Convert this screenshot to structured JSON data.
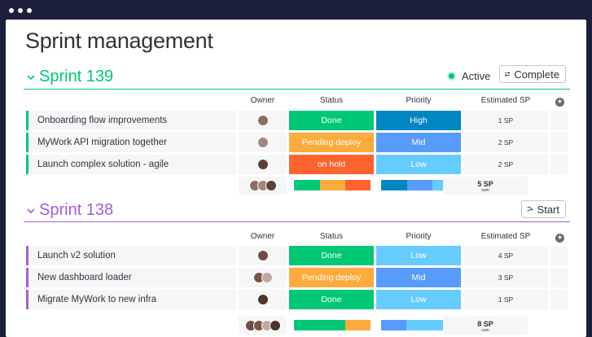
{
  "window": {
    "title": "Sprint management"
  },
  "columns": {
    "owner": "Owner",
    "status": "Status",
    "priority": "Priority",
    "estimated": "Estimated SP"
  },
  "colors": {
    "done": "#00c875",
    "pending": "#fdab3d",
    "onhold": "#ff642e",
    "high": "#0086c0",
    "mid": "#579bfc",
    "low": "#66ccff",
    "group1": "#00c875",
    "group2": "#a25ddc"
  },
  "groups": [
    {
      "name": "Sprint 139",
      "state_label": "Active",
      "action_label": "Complete",
      "action_icon": "complete-icon",
      "rows": [
        {
          "name": "Onboarding flow improvements",
          "status": "Done",
          "status_color": "#00c875",
          "priority": "High",
          "priority_color": "#0086c0",
          "sp": "1 SP"
        },
        {
          "name": "MyWork API migration together",
          "status": "Pending deploy",
          "status_color": "#fdab3d",
          "priority": "Mid",
          "priority_color": "#579bfc",
          "sp": "2 SP"
        },
        {
          "name": "Launch complex solution - agile",
          "status": "on hold",
          "status_color": "#ff642e",
          "priority": "Low",
          "priority_color": "#66ccff",
          "sp": "2 SP"
        }
      ],
      "summary": {
        "sp_total": "5 SP",
        "sp_sub": "sum",
        "status_split": [
          {
            "color": "#00c875",
            "fraction": 0.34
          },
          {
            "color": "#fdab3d",
            "fraction": 0.33
          },
          {
            "color": "#ff642e",
            "fraction": 0.33
          }
        ],
        "priority_split": [
          {
            "color": "#0086c0",
            "fraction": 0.34
          },
          {
            "color": "#579bfc",
            "fraction": 0.33
          },
          {
            "color": "#66ccff",
            "fraction": 0.33
          }
        ]
      }
    },
    {
      "name": "Sprint 138",
      "action_label": "Start",
      "action_icon": "start-icon",
      "rows": [
        {
          "name": "Launch v2 solution",
          "status": "Done",
          "status_color": "#00c875",
          "priority": "Low",
          "priority_color": "#66ccff",
          "sp": "4 SP"
        },
        {
          "name": "New dashboard loader",
          "status": "Pending deploy",
          "status_color": "#fdab3d",
          "priority": "Mid",
          "priority_color": "#579bfc",
          "sp": "3 SP"
        },
        {
          "name": "Migrate MyWork to new infra",
          "status": "Done",
          "status_color": "#00c875",
          "priority": "Low",
          "priority_color": "#66ccff",
          "sp": "1 SP"
        }
      ],
      "summary": {
        "sp_total": "8 SP",
        "sp_sub": "sum",
        "status_split": [
          {
            "color": "#00c875",
            "fraction": 0.67
          },
          {
            "color": "#fdab3d",
            "fraction": 0.33
          }
        ],
        "priority_split": [
          {
            "color": "#579bfc",
            "fraction": 0.33
          },
          {
            "color": "#66ccff",
            "fraction": 0.67
          }
        ]
      }
    }
  ]
}
